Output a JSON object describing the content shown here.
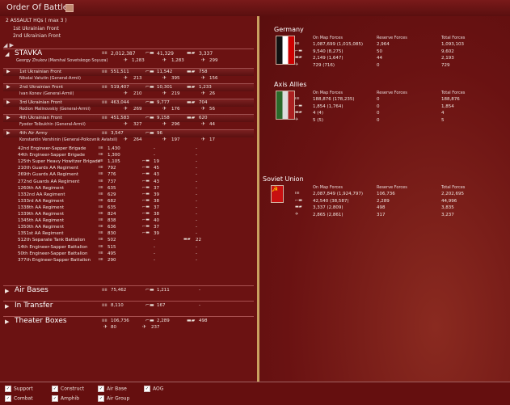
{
  "window": {
    "title": "Order Of Battle"
  },
  "header": {
    "line1": "2 ASSAULT HQs ( max 3 )",
    "line2": "1st Ukrainian Front",
    "line3": "2nd Ukrainian Front"
  },
  "stavka": {
    "name": "STAVKA",
    "commander": "Georgy Zhukov  (Marshal Sovetskogo Soyuza)",
    "men": "2,012,387",
    "guns": "41,329",
    "tanks": "3,337",
    "planes_a": "1,283",
    "planes_b": "1,283",
    "planes_c": "299"
  },
  "fronts": [
    {
      "name": "1st Ukrainian Front",
      "cmd": "Nikolai Vatutin  (General-Armii)",
      "men": "551,511",
      "guns": "11,542",
      "tanks": "758",
      "a": "213",
      "b": "395",
      "c": "156"
    },
    {
      "name": "2nd Ukrainian Front",
      "cmd": "Ivan Konev  (General-Armii)",
      "men": "519,407",
      "guns": "10,301",
      "tanks": "1,233",
      "a": "210",
      "b": "219",
      "c": "26"
    },
    {
      "name": "3rd Ukrainian Front",
      "cmd": "Rodion Malinovskiy  (General-Armii)",
      "men": "463,044",
      "guns": "9,777",
      "tanks": "704",
      "a": "269",
      "b": "176",
      "c": "56"
    },
    {
      "name": "4th Ukrainian Front",
      "cmd": "Fyodor Tolbukhin  (General-Armii)",
      "men": "451,583",
      "guns": "9,158",
      "tanks": "620",
      "a": "327",
      "b": "296",
      "c": "44"
    },
    {
      "name": "4th Air Army",
      "cmd": "Konstantin Vershinin  (General-Polkovnik Aviatsii)",
      "men": "3,547",
      "guns": "96",
      "tanks": "",
      "a": "264",
      "b": "197",
      "c": "17"
    }
  ],
  "units": [
    {
      "name": "42nd Engineer-Sapper Brigade",
      "men": "1,430",
      "guns": "-",
      "tanks": "-"
    },
    {
      "name": "44th Engineer-Sapper Brigade",
      "men": "1,300",
      "guns": "-",
      "tanks": "-"
    },
    {
      "name": "125th Super Heavy Howitzer Brigade",
      "men": "1,105",
      "guns": "19",
      "tanks": "-"
    },
    {
      "name": "210th Guards AA Regiment",
      "men": "792",
      "guns": "45",
      "tanks": "-"
    },
    {
      "name": "269th Guards AA Regiment",
      "men": "776",
      "guns": "43",
      "tanks": "-"
    },
    {
      "name": "272nd Guards AA Regiment",
      "men": "737",
      "guns": "43",
      "tanks": "-"
    },
    {
      "name": "1260th AA Regiment",
      "men": "635",
      "guns": "37",
      "tanks": "-"
    },
    {
      "name": "1332nd AA Regiment",
      "men": "629",
      "guns": "39",
      "tanks": "-"
    },
    {
      "name": "1333rd AA Regiment",
      "men": "682",
      "guns": "38",
      "tanks": "-"
    },
    {
      "name": "1338th AA Regiment",
      "men": "635",
      "guns": "37",
      "tanks": "-"
    },
    {
      "name": "1339th AA Regiment",
      "men": "824",
      "guns": "38",
      "tanks": "-"
    },
    {
      "name": "1345th AA Regiment",
      "men": "838",
      "guns": "40",
      "tanks": "-"
    },
    {
      "name": "1350th AA Regiment",
      "men": "636",
      "guns": "37",
      "tanks": "-"
    },
    {
      "name": "1351st AA Regiment",
      "men": "830",
      "guns": "39",
      "tanks": "-"
    },
    {
      "name": "512th Separate Tank Battalion",
      "men": "502",
      "guns": "-",
      "tanks": "22"
    },
    {
      "name": "14th Engineer-Sapper Battalion",
      "men": "515",
      "guns": "-",
      "tanks": "-"
    },
    {
      "name": "50th Engineer-Sapper Battalion",
      "men": "495",
      "guns": "-",
      "tanks": "-"
    },
    {
      "name": "377th Engineer-Sapper Battalion",
      "men": "290",
      "guns": "-",
      "tanks": "-"
    }
  ],
  "sections": [
    {
      "name": "Air Bases",
      "men": "75,462",
      "guns": "1,211",
      "tanks": "-"
    },
    {
      "name": "In Transfer",
      "men": "8,110",
      "guns": "167",
      "tanks": "-"
    },
    {
      "name": "Theater Boxes",
      "men": "106,736",
      "guns": "2,289",
      "tanks": "498",
      "a": "80",
      "b": "237",
      "c": "-"
    }
  ],
  "nations": [
    {
      "name": "Germany",
      "rows": [
        [
          "1,087,699 (1,015,085)",
          "2,964",
          "1,093,103"
        ],
        [
          "9,540 (8,275)",
          "50",
          "9,602"
        ],
        [
          "2,149 (1,647)",
          "44",
          "2,193"
        ],
        [
          "729 (716)",
          "0",
          "729"
        ]
      ]
    },
    {
      "name": "Axis Allies",
      "rows": [
        [
          "188,876 (178,235)",
          "0",
          "188,876"
        ],
        [
          "1,854 (1,764)",
          "0",
          "1,854"
        ],
        [
          "4 (4)",
          "0",
          "4"
        ],
        [
          "5 (5)",
          "0",
          "5"
        ]
      ]
    },
    {
      "name": "Soviet Union",
      "rows": [
        [
          "2,087,849 (1,924,797)",
          "106,736",
          "2,202,695"
        ],
        [
          "42,540 (38,587)",
          "2,289",
          "44,996"
        ],
        [
          "3,337 (2,809)",
          "498",
          "3,835"
        ],
        [
          "2,865 (2,861)",
          "317",
          "3,237"
        ]
      ]
    }
  ],
  "col_headers": {
    "on_map": "On Map Forces",
    "reserve": "Reserve Forces",
    "total": "Total Forces"
  },
  "filters": [
    {
      "label": "Support",
      "checked": "✓"
    },
    {
      "label": "Construct",
      "checked": "✓"
    },
    {
      "label": "Air Base",
      "checked": "✓"
    },
    {
      "label": "AOG",
      "checked": "✓"
    },
    {
      "label": "Combat",
      "checked": "✓"
    },
    {
      "label": "Amphib",
      "checked": "✓"
    },
    {
      "label": "Air Group",
      "checked": "✓"
    }
  ],
  "icons": {
    "men": "ıııı",
    "gun": "⌐▬",
    "tank": "▬▰",
    "plane": "✈"
  }
}
